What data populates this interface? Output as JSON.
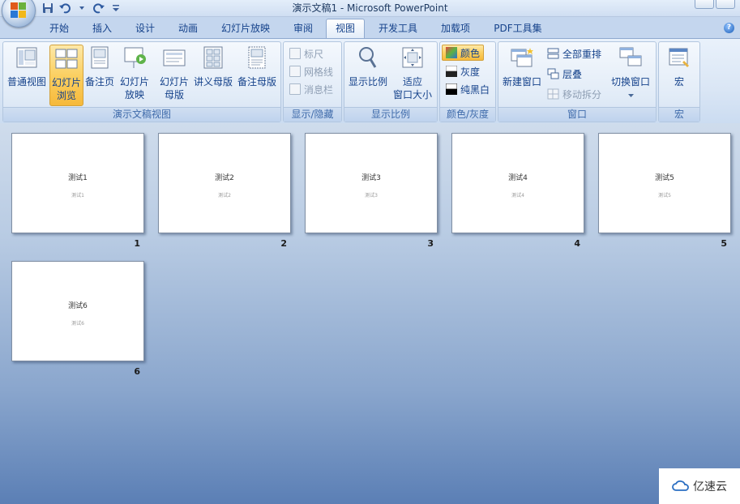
{
  "window": {
    "title": "演示文稿1 - Microsoft PowerPoint"
  },
  "tabs": [
    {
      "label": "开始"
    },
    {
      "label": "插入"
    },
    {
      "label": "设计"
    },
    {
      "label": "动画"
    },
    {
      "label": "幻灯片放映"
    },
    {
      "label": "审阅"
    },
    {
      "label": "视图"
    },
    {
      "label": "开发工具"
    },
    {
      "label": "加载项"
    },
    {
      "label": "PDF工具集"
    }
  ],
  "ribbon": {
    "presentation_views": {
      "label": "演示文稿视图",
      "normal": "普通视图",
      "sorter_line1": "幻灯片",
      "sorter_line2": "浏览",
      "notes": "备注页",
      "show_line1": "幻灯片",
      "show_line2": "放映",
      "slide_master_line1": "幻灯片",
      "slide_master_line2": "母版",
      "handout_master": "讲义母版",
      "notes_master": "备注母版"
    },
    "show_hide": {
      "label": "显示/隐藏",
      "ruler": "标尺",
      "gridlines": "网格线",
      "message_bar": "消息栏"
    },
    "zoom": {
      "label": "显示比例",
      "zoom": "显示比例",
      "fit_line1": "适应",
      "fit_line2": "窗口大小"
    },
    "color": {
      "label": "颜色/灰度",
      "color": "颜色",
      "grayscale": "灰度",
      "bw": "纯黑白"
    },
    "window": {
      "label": "窗口",
      "new_window": "新建窗口",
      "arrange_all": "全部重排",
      "cascade": "层叠",
      "move_split": "移动拆分",
      "switch_line1": "切换窗口"
    },
    "macros": {
      "label": "宏",
      "macros": "宏"
    }
  },
  "slides": [
    {
      "num": "1",
      "title": "测试1",
      "subtitle": "测试1"
    },
    {
      "num": "2",
      "title": "测试2",
      "subtitle": "测试2"
    },
    {
      "num": "3",
      "title": "测试3",
      "subtitle": "测试3"
    },
    {
      "num": "4",
      "title": "测试4",
      "subtitle": "测试4"
    },
    {
      "num": "5",
      "title": "测试5",
      "subtitle": "测试5"
    },
    {
      "num": "6",
      "title": "测试6",
      "subtitle": "测试6"
    }
  ],
  "watermark": {
    "text": "亿速云"
  },
  "colors": {
    "accent": "#15428b",
    "selected": "#fbd062"
  }
}
